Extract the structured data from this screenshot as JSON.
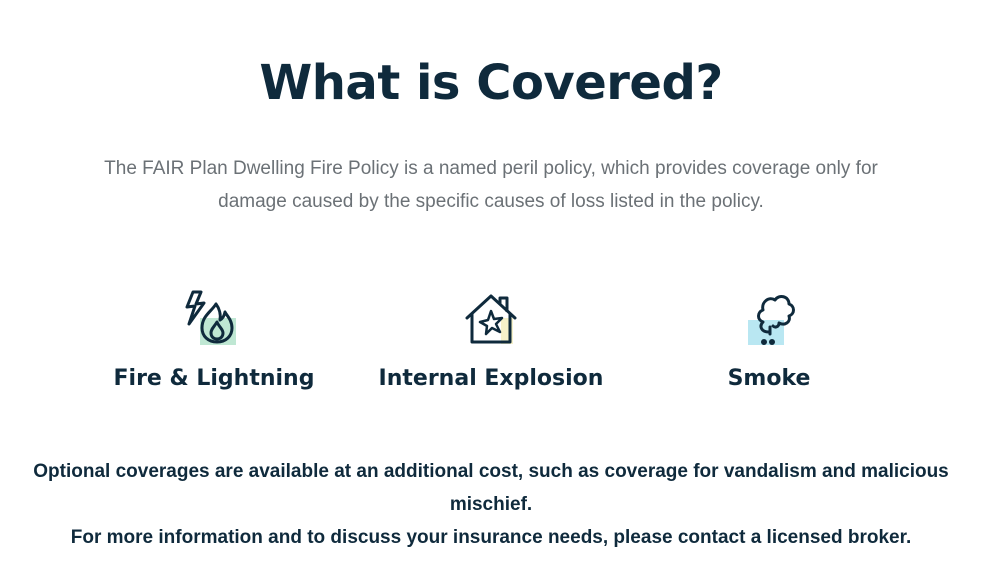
{
  "heading": {
    "title": "What is Covered?"
  },
  "intro": {
    "text": "The FAIR Plan Dwelling Fire Policy is a named peril policy, which provides coverage only for damage caused by the specific causes of loss listed in the policy."
  },
  "coverages": [
    {
      "label": "Fire & Lightning",
      "icon": "fire-lightning-icon",
      "accent": "#bfe7d3"
    },
    {
      "label": "Internal Explosion",
      "icon": "house-explosion-icon",
      "accent": "#f6f1c9"
    },
    {
      "label": "Smoke",
      "icon": "smoke-icon",
      "accent": "#b9e7f2"
    }
  ],
  "notes": {
    "optional": "Optional coverages are available at an additional cost, such as coverage for vandalism and malicious mischief.",
    "contact": "For more information and to discuss your insurance needs, please contact a licensed broker."
  },
  "colors": {
    "heading": "#0f2a3c",
    "body_text": "#6b7176",
    "icon_stroke": "#0f2a3c"
  }
}
